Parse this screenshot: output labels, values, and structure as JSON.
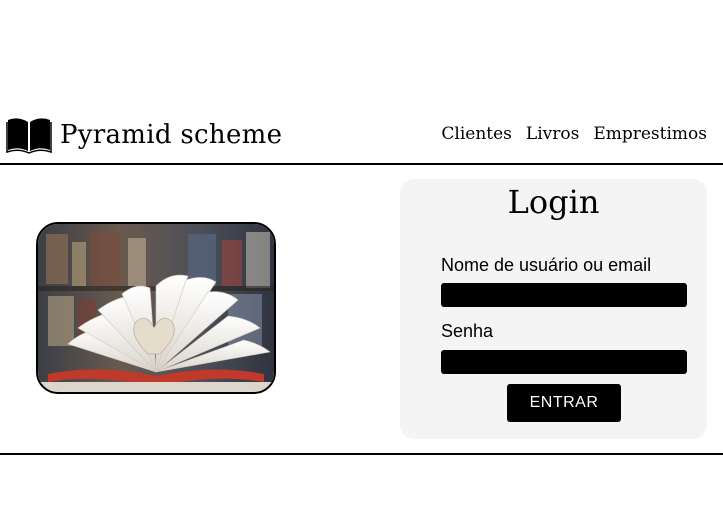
{
  "header": {
    "brand_icon": "open-book-icon",
    "brand_name": "Pyramid scheme",
    "nav": [
      "Clientes",
      "Livros",
      "Emprestimos"
    ]
  },
  "hero_image": {
    "icon": "open-book-photo"
  },
  "login": {
    "title": "Login",
    "username_label": "Nome de usuário ou email",
    "username_value": "",
    "password_label": "Senha",
    "password_value": "",
    "submit_label": "ENTRAR"
  },
  "colors": {
    "card_bg": "#f4f4f4",
    "input_bg": "#000000",
    "button_bg": "#000000",
    "button_text": "#ffffff"
  }
}
